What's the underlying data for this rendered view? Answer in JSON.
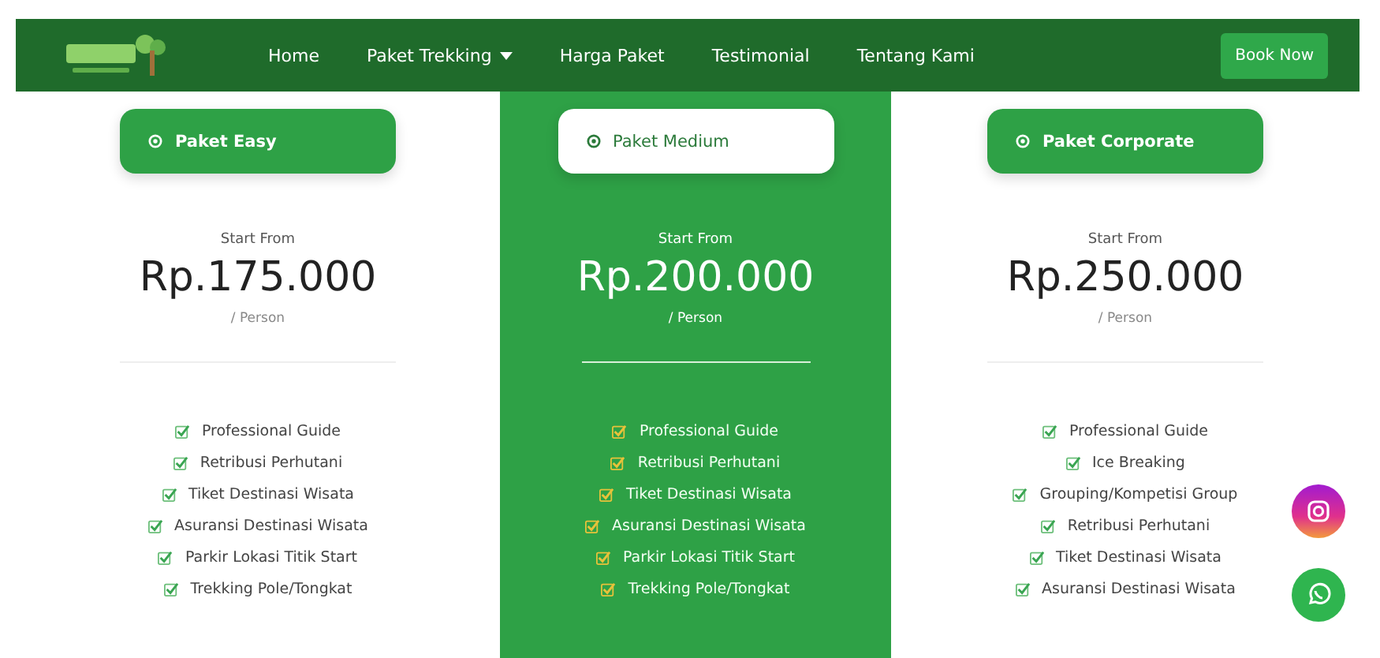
{
  "nav": {
    "items": [
      {
        "label": "Home",
        "kind": "link"
      },
      {
        "label": "Paket Trekking",
        "kind": "dropdown"
      },
      {
        "label": "Harga Paket",
        "kind": "link"
      },
      {
        "label": "Testimonial",
        "kind": "link"
      },
      {
        "label": "Tentang Kami",
        "kind": "link"
      }
    ],
    "cta": "Book Now"
  },
  "plans": [
    {
      "name": "Paket Easy",
      "selected": false,
      "start_label": "Start From",
      "price": "Rp.175.000",
      "unit": "/ Person",
      "features": [
        "Professional Guide",
        "Retribusi Perhutani",
        "Tiket Destinasi Wisata",
        "Asuransi Destinasi Wisata",
        "Parkir Lokasi Titik Start",
        "Trekking Pole/Tongkat"
      ]
    },
    {
      "name": "Paket Medium",
      "selected": true,
      "start_label": "Start From",
      "price": "Rp.200.000",
      "unit": "/ Person",
      "features": [
        "Professional Guide",
        "Retribusi Perhutani",
        "Tiket Destinasi Wisata",
        "Asuransi Destinasi Wisata",
        "Parkir Lokasi Titik Start",
        "Trekking Pole/Tongkat"
      ]
    },
    {
      "name": "Paket Corporate",
      "selected": false,
      "start_label": "Start From",
      "price": "Rp.250.000",
      "unit": "/ Person",
      "features": [
        "Professional Guide",
        "Ice Breaking",
        "Grouping/Kompetisi Group",
        "Retribusi Perhutani",
        "Tiket Destinasi Wisata",
        "Asuransi Destinasi Wisata"
      ]
    }
  ],
  "floating": [
    {
      "kind": "instagram"
    },
    {
      "kind": "whatsapp"
    }
  ]
}
